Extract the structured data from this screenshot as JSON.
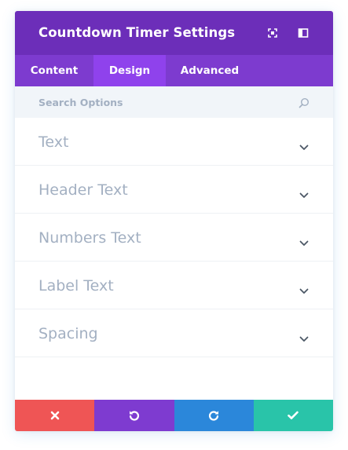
{
  "header": {
    "title": "Countdown Timer Settings",
    "icons": [
      "fullscreen-icon",
      "sidebar-toggle-icon"
    ]
  },
  "tabs": [
    {
      "label": "Content",
      "active": false
    },
    {
      "label": "Design",
      "active": true
    },
    {
      "label": "Advanced",
      "active": false
    }
  ],
  "search": {
    "placeholder": "Search Options",
    "value": "",
    "icon": "search-icon"
  },
  "sections": [
    {
      "label": "Text",
      "icon": "chevron-down-icon"
    },
    {
      "label": "Header Text",
      "icon": "chevron-down-icon"
    },
    {
      "label": "Numbers Text",
      "icon": "chevron-down-icon"
    },
    {
      "label": "Label Text",
      "icon": "chevron-down-icon"
    },
    {
      "label": "Spacing",
      "icon": "chevron-down-icon"
    }
  ],
  "footer": [
    {
      "icon": "close-icon",
      "color": "#ef5555"
    },
    {
      "icon": "undo-icon",
      "color": "#7e3bd0"
    },
    {
      "icon": "redo-icon",
      "color": "#2b87da"
    },
    {
      "icon": "check-icon",
      "color": "#29c4a9"
    }
  ],
  "colors": {
    "header_bg": "#6c2eb9",
    "tabs_bg": "#7d3bcf",
    "tab_active_bg": "#8f42ec",
    "search_bg": "#f1f5f9",
    "label_text": "#a3b0c2",
    "chevron": "#4c5866"
  }
}
